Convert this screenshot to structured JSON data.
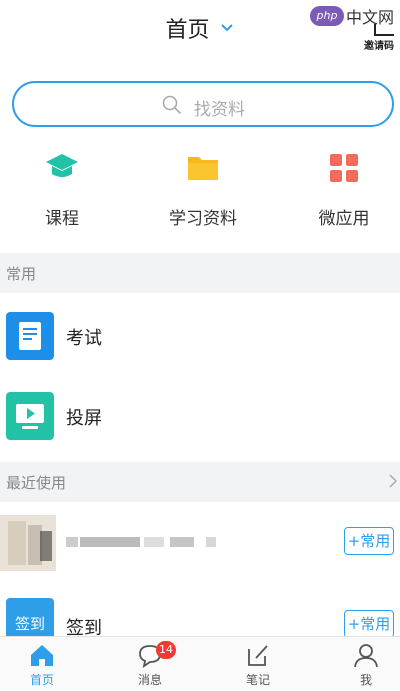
{
  "header": {
    "title": "首页",
    "watermark_logo": "php",
    "watermark_text": "中文网",
    "invite_label": "邀请码"
  },
  "search": {
    "placeholder": "找资料"
  },
  "quick_actions": [
    {
      "label": "课程",
      "icon": "graduation-cap-icon",
      "color": "#21c2a6"
    },
    {
      "label": "学习资料",
      "icon": "folder-icon",
      "color": "#f9b81e"
    },
    {
      "label": "微应用",
      "icon": "grid-apps-icon",
      "color": "#f26b5b"
    }
  ],
  "sections": {
    "common": "常用",
    "recent": "最近使用"
  },
  "common_items": [
    {
      "label": "考试",
      "icon": "exam-paper-icon",
      "color": "#1d8fe8"
    },
    {
      "label": "投屏",
      "icon": "screen-cast-icon",
      "color": "#21c2a6"
    }
  ],
  "recent_items": [
    {
      "label": "",
      "pin_label": "+常用"
    },
    {
      "label": "签到",
      "icon_text": "签到",
      "pin_label": "+常用"
    }
  ],
  "tabbar": [
    {
      "label": "首页",
      "icon": "home-icon",
      "active": true
    },
    {
      "label": "消息",
      "icon": "chat-bubble-icon",
      "badge": "14"
    },
    {
      "label": "笔记",
      "icon": "edit-note-icon"
    },
    {
      "label": "我",
      "icon": "profile-icon"
    }
  ],
  "colors": {
    "accent": "#2f9ee8",
    "badge": "#f23a2f"
  }
}
